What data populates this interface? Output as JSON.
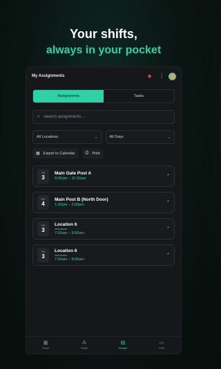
{
  "headline": {
    "line1": "Your shifts,",
    "line2": "always in your pocket"
  },
  "app": {
    "title": "My Assignments"
  },
  "tabs": [
    {
      "label": "Assignments",
      "active": true
    },
    {
      "label": "Tasks",
      "active": false
    }
  ],
  "search": {
    "placeholder": "Search assignments..."
  },
  "filters": {
    "location": "All Locations",
    "days": "All Days"
  },
  "actions": {
    "export": "Export to Calendar",
    "print": "Print"
  },
  "assignments": [
    {
      "dow": "FRI",
      "day": "3",
      "name": "Main Gate Post A",
      "sub": "",
      "time": "9:00am – 11:00am"
    },
    {
      "dow": "SAT",
      "day": "4",
      "name": "Main Post B (North Door)",
      "sub": "",
      "time": "1:00pm – 3:00pm"
    },
    {
      "dow": "FRI",
      "day": "3",
      "name": "Location 6",
      "sub": "Attendants",
      "time": "7:00am – 9:00am"
    },
    {
      "dow": "FRI",
      "day": "3",
      "name": "Location 6",
      "sub": "Attendants",
      "time": "7:00am – 9:00am"
    }
  ],
  "nav": [
    {
      "label": "Home",
      "icon": "home-icon"
    },
    {
      "label": "Graph",
      "icon": "graph-icon"
    },
    {
      "label": "Assignt",
      "icon": "assignments-icon",
      "active": true
    },
    {
      "label": "Chat",
      "icon": "chat-icon"
    }
  ],
  "colors": {
    "accent": "#2fd1a8",
    "background": "#0a1512",
    "card": "#181b1e",
    "alert": "#e0413a"
  }
}
